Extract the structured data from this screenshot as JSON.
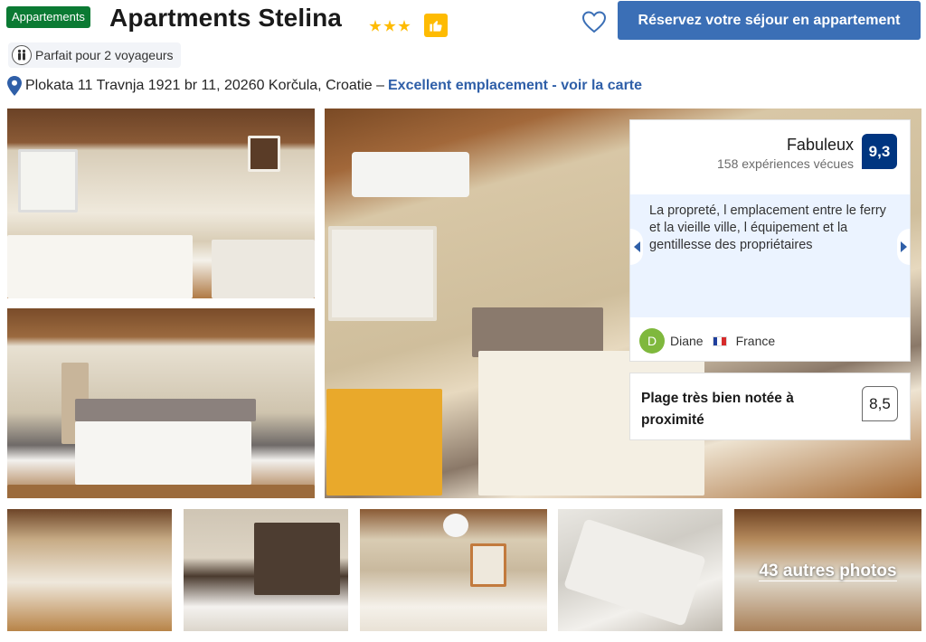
{
  "header": {
    "badge": "Appartements",
    "title": "Apartments Stelina",
    "star_count": 3,
    "reserve_label": "Réservez votre séjour en appartement",
    "travellers_label": "Parfait pour 2 voyageurs"
  },
  "location": {
    "address": "Plokata 11 Travnja 1921 br 11, 20260 Korčula, Croatie –",
    "map_link": "Excellent emplacement - voir la carte"
  },
  "gallery": {
    "more_photos": "43 autres photos"
  },
  "review_summary": {
    "label": "Fabuleux",
    "count": "158 expériences vécues",
    "score": "9,3",
    "quote": "La propreté, l emplacement entre le ferry et la vieille ville, l équipement et la gentillesse des propriétaires",
    "reviewer_initial": "D",
    "reviewer_name": "Diane",
    "reviewer_country": "France"
  },
  "beach": {
    "label": "Plage très bien notée à proximité",
    "score": "8,5"
  },
  "colors": {
    "brand_blue": "#003580",
    "button_blue": "#3b6fb6",
    "link_blue": "#2f5fa8",
    "badge_green": "#0b7a33",
    "star_yellow": "#febb02"
  },
  "icons": {
    "thumb": "thumbs-up-icon",
    "heart": "heart-icon",
    "location": "map-pin-icon",
    "travellers": "people-icon"
  }
}
